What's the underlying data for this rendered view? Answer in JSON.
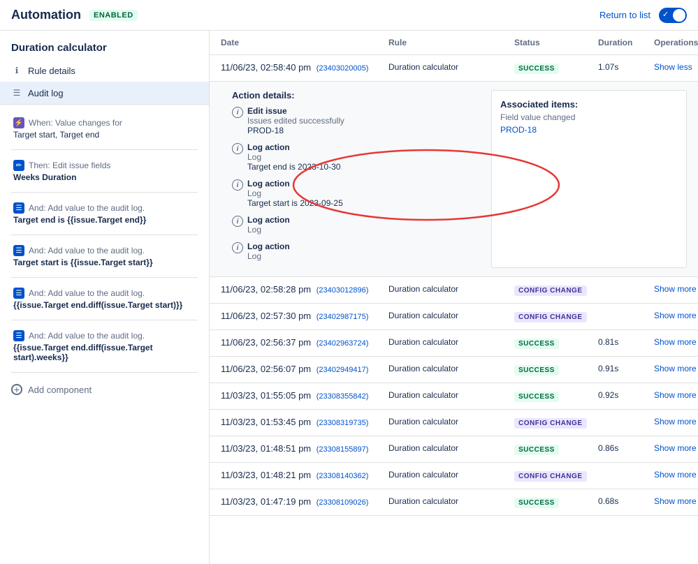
{
  "topbar": {
    "title": "Automation",
    "status": "ENABLED",
    "return_label": "Return to list"
  },
  "sidebar": {
    "header": "Duration calculator",
    "nav": [
      {
        "id": "rule-details",
        "label": "Rule details",
        "icon": "ℹ"
      },
      {
        "id": "audit-log",
        "label": "Audit log",
        "icon": "☰"
      }
    ],
    "rules": [
      {
        "type": "trigger",
        "label": "When: Value changes for",
        "subtitle": "Target start, Target end",
        "bold": false
      },
      {
        "type": "action",
        "label": "Then: Edit issue fields",
        "subtitle": "Weeks Duration",
        "bold": true
      },
      {
        "type": "audit",
        "label": "And: Add value to the audit log.",
        "subtitle": "Target end is {{issue.Target end}}",
        "bold": true
      },
      {
        "type": "audit",
        "label": "And: Add value to the audit log.",
        "subtitle": "Target start is {{issue.Target start}}",
        "bold": true
      },
      {
        "type": "audit",
        "label": "And: Add value to the audit log.",
        "subtitle": "{{issue.Target end.diff(issue.Target start)}}",
        "bold": true
      },
      {
        "type": "audit",
        "label": "And: Add value to the audit log.",
        "subtitle": "{{issue.Target end.diff(issue.Target start).weeks}}",
        "bold": true
      }
    ],
    "add_component_label": "Add component"
  },
  "table": {
    "headers": [
      "Date",
      "Rule",
      "Status",
      "Duration",
      "Operations"
    ],
    "rows": [
      {
        "date": "11/06/23, 02:58:40 pm",
        "id": "(23403020005)",
        "rule": "Duration calculator",
        "status": "SUCCESS",
        "duration": "1.07s",
        "ops": "Show less",
        "expanded": true,
        "detail": {
          "actions": [
            {
              "title": "Edit issue",
              "sub": "Issues edited successfully",
              "value": "PROD-18"
            },
            {
              "title": "Log action",
              "sub": "Log",
              "value": "Target end is 2023-10-30"
            },
            {
              "title": "Log action",
              "sub": "Log",
              "value": "Target start is 2023-09-25"
            },
            {
              "title": "Log action",
              "sub": "Log",
              "value": ""
            },
            {
              "title": "Log action",
              "sub": "Log",
              "value": ""
            }
          ],
          "associated_title": "Associated items:",
          "associated_sub": "Field value changed",
          "associated_link": "PROD-18"
        }
      },
      {
        "date": "11/06/23, 02:58:28 pm",
        "id": "(23403012896)",
        "rule": "Duration calculator",
        "status": "CONFIG CHANGE",
        "duration": "",
        "ops": "Show more",
        "expanded": false
      },
      {
        "date": "11/06/23, 02:57:30 pm",
        "id": "(23402987175)",
        "rule": "Duration calculator",
        "status": "CONFIG CHANGE",
        "duration": "",
        "ops": "Show more",
        "expanded": false
      },
      {
        "date": "11/06/23, 02:56:37 pm",
        "id": "(23402963724)",
        "rule": "Duration calculator",
        "status": "SUCCESS",
        "duration": "0.81s",
        "ops": "Show more",
        "expanded": false
      },
      {
        "date": "11/06/23, 02:56:07 pm",
        "id": "(23402949417)",
        "rule": "Duration calculator",
        "status": "SUCCESS",
        "duration": "0.91s",
        "ops": "Show more",
        "expanded": false
      },
      {
        "date": "11/03/23, 01:55:05 pm",
        "id": "(23308355842)",
        "rule": "Duration calculator",
        "status": "SUCCESS",
        "duration": "0.92s",
        "ops": "Show more",
        "expanded": false
      },
      {
        "date": "11/03/23, 01:53:45 pm",
        "id": "(23308319735)",
        "rule": "Duration calculator",
        "status": "CONFIG CHANGE",
        "duration": "",
        "ops": "Show more",
        "expanded": false
      },
      {
        "date": "11/03/23, 01:48:51 pm",
        "id": "(23308155897)",
        "rule": "Duration calculator",
        "status": "SUCCESS",
        "duration": "0.86s",
        "ops": "Show more",
        "expanded": false
      },
      {
        "date": "11/03/23, 01:48:21 pm",
        "id": "(23308140362)",
        "rule": "Duration calculator",
        "status": "CONFIG CHANGE",
        "duration": "",
        "ops": "Show more",
        "expanded": false
      },
      {
        "date": "11/03/23, 01:47:19 pm",
        "id": "(23308109026)",
        "rule": "Duration calculator",
        "status": "SUCCESS",
        "duration": "0.68s",
        "ops": "Show more",
        "expanded": false
      }
    ]
  }
}
